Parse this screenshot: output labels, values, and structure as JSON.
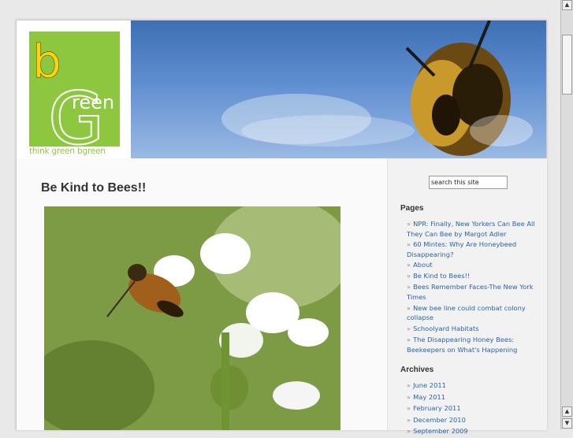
{
  "logo": {
    "letter_b": "b",
    "word": "reen",
    "letter_g": "G",
    "tagline": "think green bgreen"
  },
  "post": {
    "title": "Be Kind to Bees!!"
  },
  "search": {
    "placeholder": "search this site"
  },
  "sidebar": {
    "pages_title": "Pages",
    "pages": [
      "NPR: Finally, New Yorkers Can Bee All They Can Bee by Margot Adler",
      "60 Mintes: Why Are Honeybeed Disappearing?",
      "About",
      "Be Kind to Bees!!",
      "Bees Remember Faces-The New York Times",
      "New bee line could combat colony collapse",
      "Schoolyard Habitats",
      "The Disappearing Honey Bees: Beekeepers on What's Happening"
    ],
    "archives_title": "Archives",
    "archives": [
      "June 2011",
      "May 2011",
      "February 2011",
      "December 2010",
      "September 2009"
    ]
  },
  "colors": {
    "brand_green": "#8dc63f",
    "link_blue": "#2a63a8"
  },
  "icons": {
    "scroll_up": "arrow-up-icon",
    "scroll_down": "arrow-down-icon"
  }
}
